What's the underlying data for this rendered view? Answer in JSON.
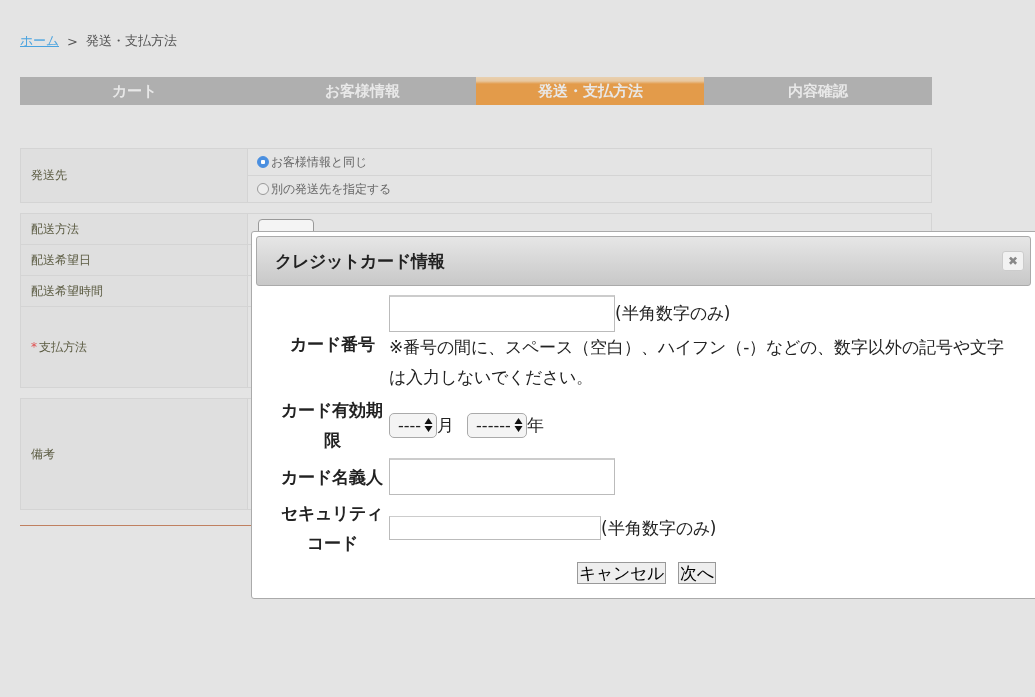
{
  "breadcrumb": {
    "home_link": "ホーム",
    "separator": ">",
    "current": "発送・支払方法"
  },
  "steps": [
    {
      "label": "カート",
      "selected": false
    },
    {
      "label": "お客様情報",
      "selected": false
    },
    {
      "label": "発送・支払方法",
      "selected": true
    },
    {
      "label": "内容確認",
      "selected": false
    }
  ],
  "shipping_destination": {
    "label": "発送先",
    "options": [
      {
        "label": "お客様情報と同じ",
        "selected": true
      },
      {
        "label": "別の発送先を指定する",
        "selected": false
      }
    ]
  },
  "order_rows": [
    {
      "label": "配送方法",
      "required": false
    },
    {
      "label": "配送希望日",
      "required": false
    },
    {
      "label": "配送希望時間",
      "required": false
    },
    {
      "label": "支払方法",
      "required": true,
      "required_mark": "*"
    }
  ],
  "remarks": {
    "label": "備考"
  },
  "dialog": {
    "title": "クレジットカード情報",
    "close": "✖",
    "card_number": {
      "label": "カード番号",
      "hint": "(半角数字のみ)",
      "note": "※番号の間に、スペース（空白）、ハイフン（-）などの、数字以外の記号や文字は入力しないでください。"
    },
    "expiry": {
      "label": "カード有効期限",
      "month_select": "----",
      "month_unit": "月",
      "year_select": "------",
      "year_unit": "年"
    },
    "holder": {
      "label": "カード名義人"
    },
    "security_code": {
      "label": "セキュリティコード",
      "hint": "(半角数字のみ)"
    },
    "buttons": [
      "キャンセル",
      "次へ"
    ]
  }
}
